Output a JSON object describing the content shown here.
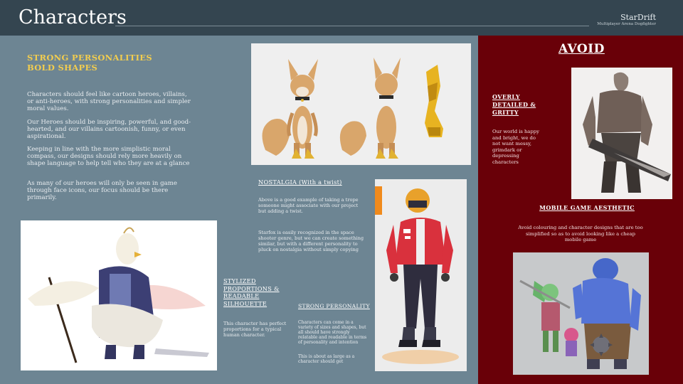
{
  "header": {
    "title": "Characters",
    "brand": "StarDrift",
    "brand_subtitle": "Multiplayer Arena Dogfighter"
  },
  "intro": {
    "heading_line1": "STRONG PERSONALITIES",
    "heading_line2": "BOLD SHAPES",
    "paragraphs": [
      "Characters should feel like cartoon heroes, villains, or anti-heroes, with strong personalities and simpler moral values.",
      "Our Heroes should be inspiring, powerful, and good-hearted, and our villains cartoonish, funny, or even aspirational.",
      "Keeping in line with the more simplistic moral compass, our designs should rely more heavily on shape language to help tell who they are at a glance",
      "As many of our heroes will only be seen in game through face icons, our focus should be there primarily."
    ]
  },
  "nostalgia": {
    "heading": "NOSTALGIA (With a twist)",
    "paragraphs": [
      "Above is a good example of taking a trope someone might associate with our project but adding a twist.",
      "Starfox is easily recognized in the space shooter genre, but we can create something similar, but with a different personality to pluck on nostalgia without simply copying"
    ]
  },
  "stylized": {
    "heading": "STYLIZED PROPORTIONS & READABLE SILHOUETTE",
    "paragraph": "This character has perfect proportions for a typical human character."
  },
  "strong_personality": {
    "heading": "STRONG PERSONALITY",
    "paragraphs": [
      "Characters can come in a variety of sizes and shapes, but all should have strongly relatable and readable in terms of personality and intention",
      "This is about as large as a character should get"
    ]
  },
  "avoid": {
    "title": "AVOID",
    "overly_heading": "OVERLY DETAILED & GRITTY",
    "overly_text": "Our world is happy and bright, we do not want messy, grimdark or depressing characters",
    "mobile_heading": "MOBILE GAME AESTHETIC",
    "mobile_text": "Avoid colouring and character designs that are too simplified so as to avoid looking like a cheap mobile game"
  },
  "images": {
    "fox_sheet": "fox-character-turnaround",
    "bird_knight": "bird-knight-character",
    "pilot": "pilot-character",
    "gritty_warrior": "gritty-warrior-character",
    "mobile_heroes": "mobile-game-heroes"
  },
  "colors": {
    "header_bg": "#344550",
    "panel_bg": "#6d8593",
    "avoid_bg": "#690008",
    "heading_yellow": "#f2cd4f"
  }
}
